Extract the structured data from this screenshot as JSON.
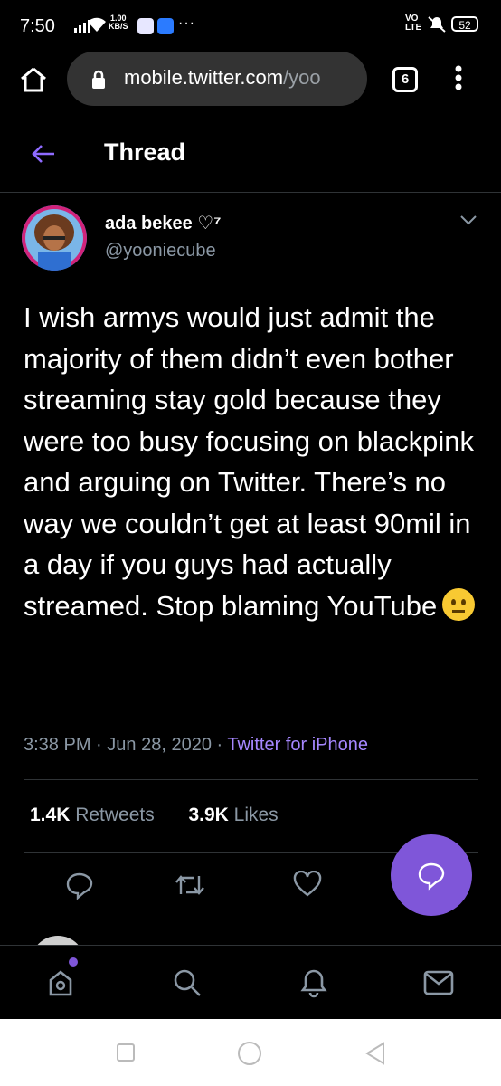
{
  "status": {
    "time": "7:50",
    "speed_value": "1.00",
    "speed_unit": "KB/S",
    "more": "···",
    "volte": "VO LTE",
    "battery": "52"
  },
  "browser": {
    "url_main": "mobile.twitter.com",
    "url_rest": "/yoo",
    "tab_count": "6"
  },
  "header": {
    "title": "Thread"
  },
  "tweet": {
    "display_name": "ada bekee ♡⁷",
    "handle": "@yooniecube",
    "text": "I wish armys would just admit the majority of them didn’t even bother streaming stay gold because they were too busy focusing on blackpink and arguing on Twitter. There’s no way we couldn’t get at least 90mil in a day if you guys had actually streamed. Stop blaming YouTube",
    "time": "3:38 PM",
    "sep1": "·",
    "date": "Jun 28, 2020",
    "sep2": "·",
    "source": "Twitter for iPhone",
    "retweets_count": "1.4K",
    "retweets_label": "Retweets",
    "likes_count": "3.9K",
    "likes_label": "Likes"
  },
  "colors": {
    "accent": "#7f56d9",
    "text_secondary": "#8b98a5",
    "source_link": "#a687ff"
  },
  "icons": [
    "home-icon",
    "lock-icon",
    "menu-dots-icon",
    "back-arrow-icon",
    "chevron-down-icon",
    "reply-icon",
    "retweet-icon",
    "like-icon",
    "compose-reply-icon",
    "explore-home-icon",
    "search-icon",
    "notifications-icon",
    "messages-icon"
  ]
}
